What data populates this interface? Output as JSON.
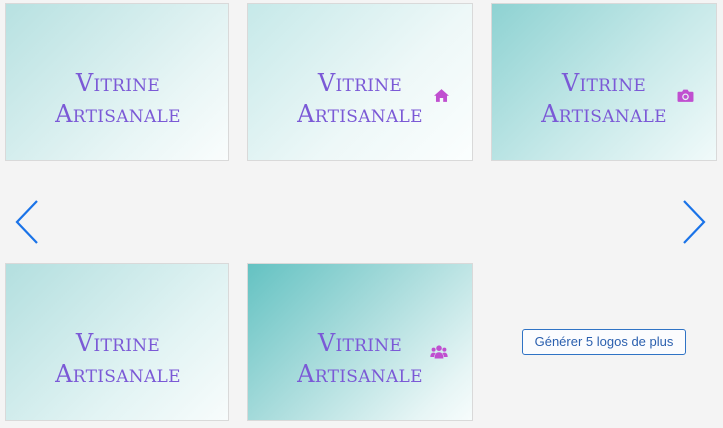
{
  "gallery": {
    "tiles": [
      {
        "line1": "Vitrine",
        "line2": "Artisanale",
        "icon": "none"
      },
      {
        "line1": "Vitrine",
        "line2": "Artisanale",
        "icon": "home-icon"
      },
      {
        "line1": "Vitrine",
        "line2": "Artisanale",
        "icon": "camera-icon"
      },
      {
        "line1": "Vitrine",
        "line2": "Artisanale",
        "icon": "none"
      },
      {
        "line1": "Vitrine",
        "line2": "Artisanale",
        "icon": "users-icon"
      }
    ],
    "generate_more_label": "Générer 5 logos de plus"
  },
  "navigation": {
    "prev_icon": "chevron-left-icon",
    "next_icon": "chevron-right-icon"
  },
  "colors": {
    "page_background": "#f4f4f4",
    "logo_text": "#7b59d6",
    "icon": "#c04fd0",
    "nav_arrow": "#1a73e8",
    "button_border": "#2f73c5",
    "tile_gradient": "#64c2c2"
  }
}
